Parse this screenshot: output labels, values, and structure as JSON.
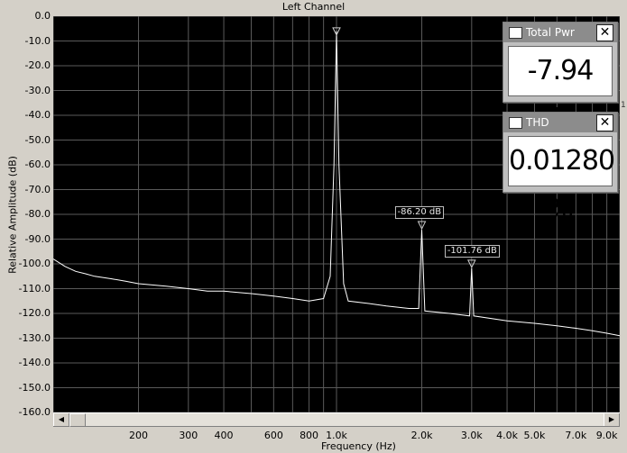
{
  "chart_data": {
    "type": "line",
    "title": "Left Channel",
    "ylabel": "Relative Amplitude (dB)",
    "xlabel": "Frequency (Hz)",
    "x_scale": "log",
    "xlim": [
      100,
      10000
    ],
    "ylim": [
      -160,
      0
    ],
    "y_ticks": [
      "0.0",
      "-10.0",
      "-20.0",
      "-30.0",
      "-40.0",
      "-50.0",
      "-60.0",
      "-70.0",
      "-80.0",
      "-90.0",
      "-100.0",
      "-110.0",
      "-120.0",
      "-130.0",
      "-140.0",
      "-150.0",
      "-160.0"
    ],
    "x_ticks": [
      {
        "value": 200,
        "label": "200"
      },
      {
        "value": 300,
        "label": "300"
      },
      {
        "value": 400,
        "label": "400"
      },
      {
        "value": 600,
        "label": "600"
      },
      {
        "value": 800,
        "label": "800"
      },
      {
        "value": 1000,
        "label": "1.0k"
      },
      {
        "value": 2000,
        "label": "2.0k"
      },
      {
        "value": 3000,
        "label": "3.0k"
      },
      {
        "value": 4000,
        "label": "4.0k"
      },
      {
        "value": 5000,
        "label": "5.0k"
      },
      {
        "value": 7000,
        "label": "7.0k"
      },
      {
        "value": 9000,
        "label": "9.0k"
      }
    ],
    "grid": true,
    "series": [
      {
        "color": "#ffffff",
        "points": [
          [
            100,
            -98
          ],
          [
            110,
            -101
          ],
          [
            120,
            -103
          ],
          [
            130,
            -104
          ],
          [
            140,
            -105
          ],
          [
            160,
            -106
          ],
          [
            180,
            -107
          ],
          [
            200,
            -108
          ],
          [
            250,
            -109
          ],
          [
            300,
            -110
          ],
          [
            350,
            -111
          ],
          [
            400,
            -111
          ],
          [
            500,
            -112
          ],
          [
            600,
            -113
          ],
          [
            700,
            -114
          ],
          [
            800,
            -115
          ],
          [
            900,
            -114
          ],
          [
            950,
            -105
          ],
          [
            980,
            -60
          ],
          [
            1000,
            -6
          ],
          [
            1020,
            -60
          ],
          [
            1060,
            -108
          ],
          [
            1100,
            -115
          ],
          [
            1300,
            -116
          ],
          [
            1500,
            -117
          ],
          [
            1800,
            -118
          ],
          [
            1950,
            -118
          ],
          [
            2000,
            -86.2
          ],
          [
            2050,
            -119
          ],
          [
            2500,
            -120
          ],
          [
            2950,
            -121
          ],
          [
            3000,
            -101.76
          ],
          [
            3050,
            -121
          ],
          [
            4000,
            -123
          ],
          [
            5000,
            -124
          ],
          [
            6000,
            -125
          ],
          [
            7000,
            -126
          ],
          [
            8000,
            -127
          ],
          [
            9000,
            -128
          ],
          [
            10000,
            -129
          ]
        ]
      }
    ],
    "markers": [
      {
        "x": 1000,
        "y": -7.94,
        "label": ""
      },
      {
        "x": 2000,
        "y": -86.2,
        "label": "-86.20 dB"
      },
      {
        "x": 3000,
        "y": -101.76,
        "label": "-101.76 dB"
      }
    ]
  },
  "meters": {
    "total_power": {
      "title": "Total Pwr",
      "value": "-7.94 dB"
    },
    "thd": {
      "title": "THD",
      "value": "0.01280 %"
    }
  },
  "scrollbar": {
    "left_arrow": "◀",
    "right_arrow": "▶"
  },
  "right_tick": "1"
}
